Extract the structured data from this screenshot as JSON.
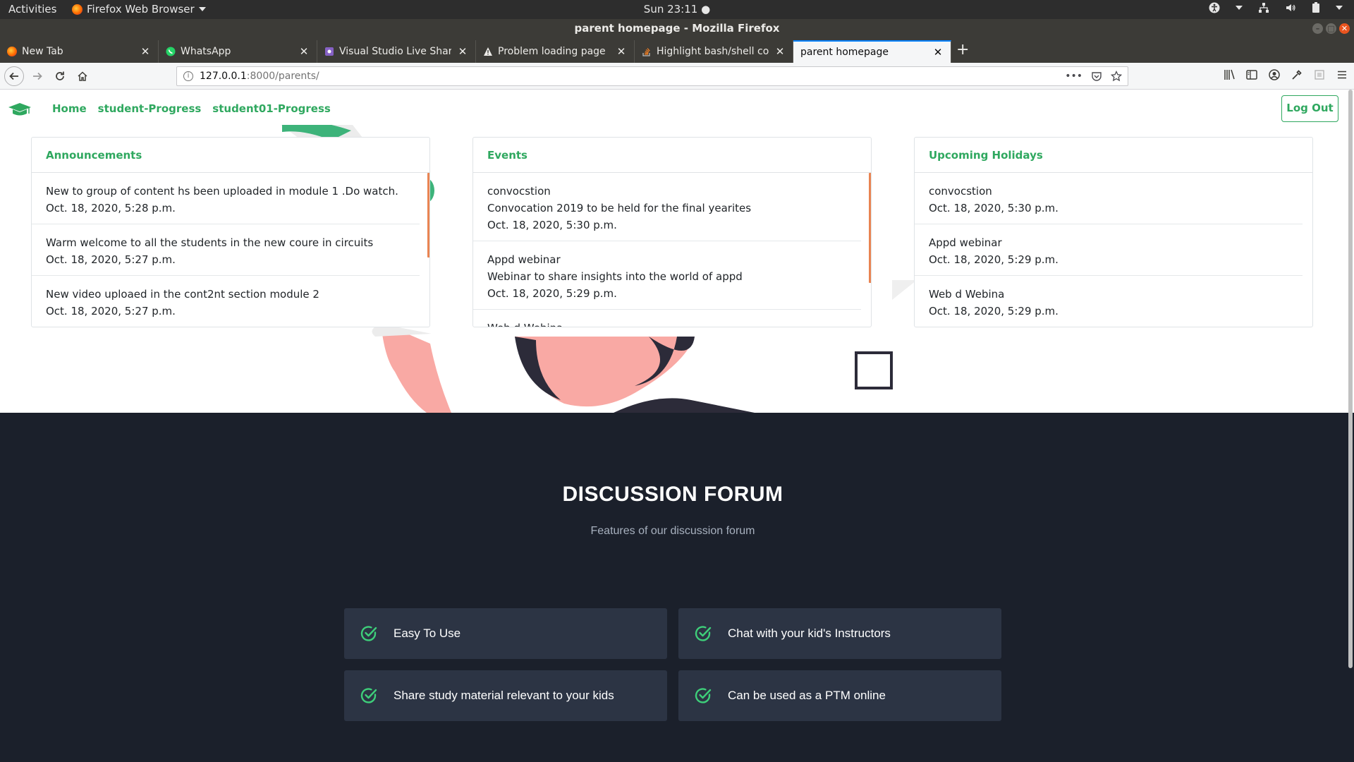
{
  "system": {
    "activities": "Activities",
    "app_menu": "Firefox Web Browser",
    "clock": "Sun 23:11 ●"
  },
  "window": {
    "title": "parent homepage - Mozilla Firefox"
  },
  "tabs": [
    {
      "label": "New Tab",
      "icon": "firefox-icon"
    },
    {
      "label": "WhatsApp",
      "icon": "whatsapp-icon"
    },
    {
      "label": "Visual Studio Live Share",
      "icon": "vs-live-share-icon"
    },
    {
      "label": "Problem loading page",
      "icon": "warning-icon"
    },
    {
      "label": "Highlight bash/shell code",
      "icon": "stackoverflow-icon"
    },
    {
      "label": "parent homepage",
      "icon": "none",
      "active": true
    }
  ],
  "url": {
    "host": "127.0.0.1",
    "rest": ":8000/parents/"
  },
  "site_nav": {
    "links": [
      "Home",
      "student-Progress",
      "student01-Progress"
    ],
    "logout": "Log Out"
  },
  "cards": {
    "announcements": {
      "title": "Announcements",
      "items": [
        {
          "text": "New to group of content hs been uploaded in module 1 .Do watch.",
          "date": "Oct. 18, 2020, 5:28 p.m."
        },
        {
          "text": "Warm welcome to all the students in the new coure in circuits",
          "date": "Oct. 18, 2020, 5:27 p.m."
        },
        {
          "text": "New video uploaed in the cont2nt section module 2",
          "date": "Oct. 18, 2020, 5:27 p.m."
        }
      ]
    },
    "events": {
      "title": "Events",
      "items": [
        {
          "name": "convocstion",
          "desc": "Convocation 2019 to be held for the final yearites",
          "date": "Oct. 18, 2020, 5:30 p.m."
        },
        {
          "name": "Appd webinar",
          "desc": "Webinar to share insights into the world of appd",
          "date": "Oct. 18, 2020, 5:29 p.m."
        },
        {
          "name": "Web d Webina",
          "desc": "",
          "date": ""
        }
      ]
    },
    "holidays": {
      "title": "Upcoming Holidays",
      "items": [
        {
          "name": "convocstion",
          "date": "Oct. 18, 2020, 5:30 p.m."
        },
        {
          "name": "Appd webinar",
          "date": "Oct. 18, 2020, 5:29 p.m."
        },
        {
          "name": "Web d Webina",
          "date": "Oct. 18, 2020, 5:29 p.m."
        }
      ]
    }
  },
  "forum": {
    "title": "DISCUSSION FORUM",
    "subtitle": "Features of our discussion forum",
    "features": [
      "Easy To Use",
      "Chat with your kid's Instructors",
      "Share study material relevant to your kids",
      "Can be used as a PTM online"
    ]
  },
  "colors": {
    "brand_green": "#2fa85f",
    "dark_section": "#1b202b",
    "feature_card": "#2c3444",
    "scroll_accent": "#e98452"
  }
}
